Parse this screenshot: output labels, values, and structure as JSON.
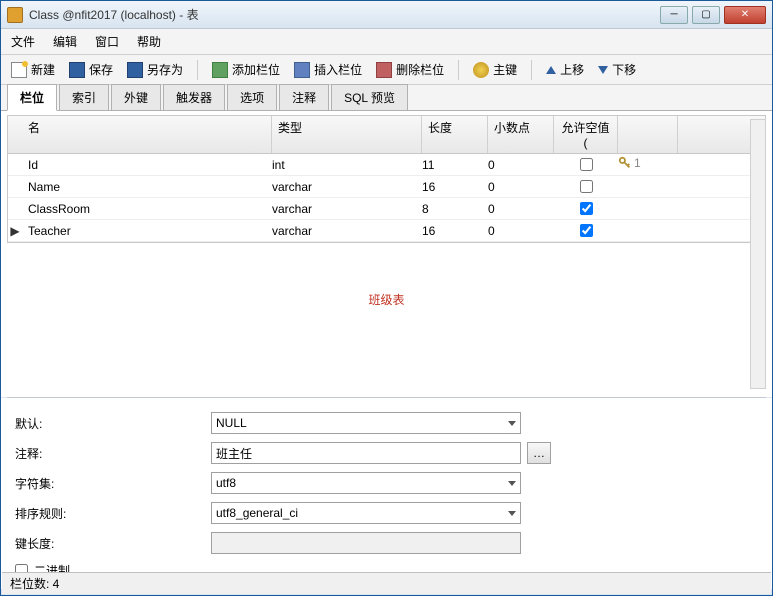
{
  "window": {
    "title": "Class @nfit2017 (localhost) - 表"
  },
  "menu": {
    "file": "文件",
    "edit": "编辑",
    "window": "窗口",
    "help": "帮助"
  },
  "toolbar": {
    "new": "新建",
    "save": "保存",
    "saveas": "另存为",
    "addcol": "添加栏位",
    "inscol": "插入栏位",
    "delcol": "删除栏位",
    "pk": "主键",
    "up": "上移",
    "down": "下移"
  },
  "tabs": {
    "cols": "栏位",
    "idx": "索引",
    "fk": "外键",
    "trg": "触发器",
    "opt": "选项",
    "cmt": "注释",
    "sql": "SQL 预览"
  },
  "grid": {
    "head": {
      "name": "名",
      "type": "类型",
      "len": "长度",
      "dec": "小数点",
      "null": "允许空值 ("
    },
    "rows": [
      {
        "mark": "",
        "name": "Id",
        "type": "int",
        "len": "11",
        "dec": "0",
        "null": false,
        "key": "1"
      },
      {
        "mark": "",
        "name": "Name",
        "type": "varchar",
        "len": "16",
        "dec": "0",
        "null": false,
        "key": ""
      },
      {
        "mark": "",
        "name": "ClassRoom",
        "type": "varchar",
        "len": "8",
        "dec": "0",
        "null": true,
        "key": ""
      },
      {
        "mark": "▶",
        "name": "Teacher",
        "type": "varchar",
        "len": "16",
        "dec": "0",
        "null": true,
        "key": ""
      }
    ]
  },
  "centerLabel": "班级表",
  "form": {
    "default_lbl": "默认:",
    "default_val": "NULL",
    "comment_lbl": "注释:",
    "comment_val": "班主任",
    "charset_lbl": "字符集:",
    "charset_val": "utf8",
    "collate_lbl": "排序规则:",
    "collate_val": "utf8_general_ci",
    "keylen_lbl": "键长度:",
    "keylen_val": "",
    "binary_lbl": "二进制"
  },
  "status": {
    "text": "栏位数: 4"
  }
}
